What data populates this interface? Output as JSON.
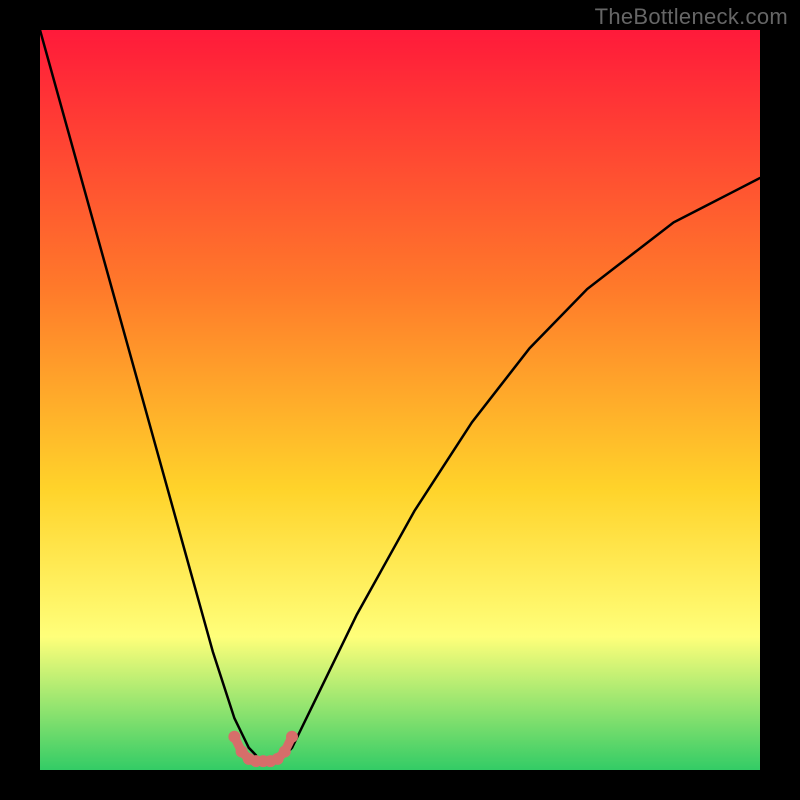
{
  "watermark": "TheBottleneck.com",
  "chart_data": {
    "type": "line",
    "title": "",
    "xlabel": "",
    "ylabel": "",
    "xlim": [
      0,
      100
    ],
    "ylim": [
      0,
      100
    ],
    "background_gradient": {
      "top": "#ff1a3a",
      "mid1": "#ff7a2a",
      "mid2": "#ffd32a",
      "mid3": "#ffff7a",
      "bottom": "#33cc66"
    },
    "series": [
      {
        "name": "curve-left",
        "color": "#000000",
        "x": [
          0,
          2,
          4,
          6,
          8,
          10,
          12,
          14,
          16,
          18,
          20,
          22,
          24,
          26,
          27,
          28,
          29,
          30
        ],
        "y": [
          100,
          93,
          86,
          79,
          72,
          65,
          58,
          51,
          44,
          37,
          30,
          23,
          16,
          10,
          7,
          5,
          3,
          2
        ]
      },
      {
        "name": "curve-right",
        "color": "#000000",
        "x": [
          34,
          35,
          36,
          38,
          40,
          44,
          48,
          52,
          56,
          60,
          64,
          68,
          72,
          76,
          80,
          84,
          88,
          92,
          96,
          100
        ],
        "y": [
          2,
          3,
          5,
          9,
          13,
          21,
          28,
          35,
          41,
          47,
          52,
          57,
          61,
          65,
          68,
          71,
          74,
          76,
          78,
          80
        ]
      },
      {
        "name": "valley-band",
        "color": "#d66e6a",
        "x": [
          27,
          28,
          29,
          30,
          31,
          32,
          33,
          34,
          35
        ],
        "y": [
          4.5,
          2.5,
          1.5,
          1.2,
          1.2,
          1.2,
          1.5,
          2.5,
          4.5
        ]
      }
    ],
    "annotations": []
  },
  "plot": {
    "viewbox_w": 720,
    "viewbox_h": 740
  }
}
